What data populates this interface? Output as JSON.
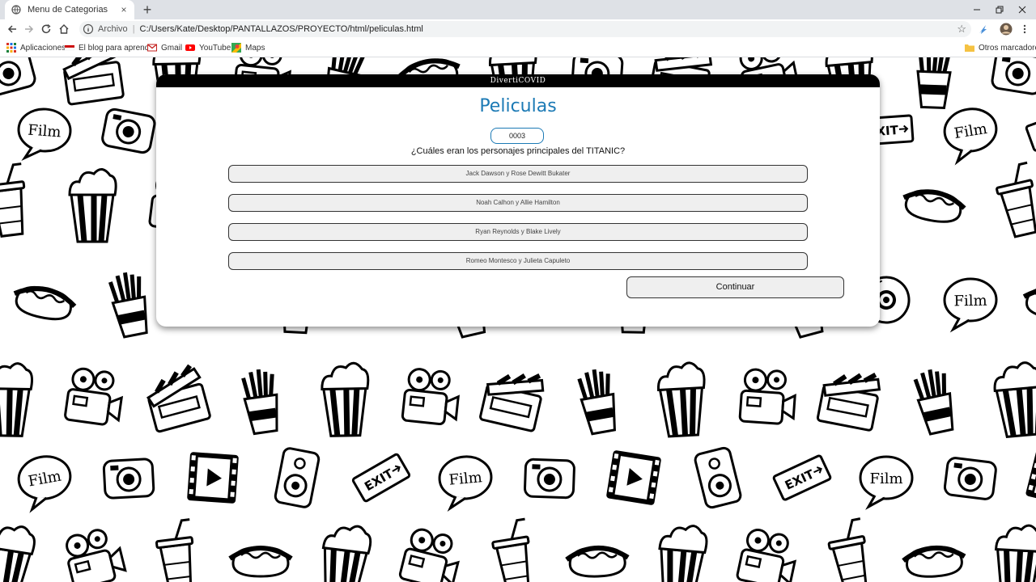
{
  "browser": {
    "tab_title": "Menu de Categorias",
    "tab_close": "×",
    "new_tab": "+",
    "address_secure_label": "Archivo",
    "address_url": "C:/Users/Kate/Desktop/PANTALLAZOS/PROYECTO/html/peliculas.html",
    "bookmarks": [
      "Aplicaciones",
      "El blog para aprend...",
      "Gmail",
      "YouTube",
      "Maps"
    ],
    "other_bookmarks": "Otros marcadores",
    "colors": {
      "tabstrip": "#dee1e6",
      "accent": "#1c7ab5"
    }
  },
  "card": {
    "header": "DivertiCOVID",
    "category_title": "Peliculas",
    "code": "0003",
    "question": "¿Cuáles eran los personajes principales del TITANIC?",
    "answers": [
      "Jack Dawson y Rose Dewitt Bukater",
      "Noah Calhon y Allie Hamilton",
      "Ryan Reynolds y Blake Lively",
      "Romeo Montesco y Julieta Capuleto"
    ],
    "continue_label": "Continuar"
  },
  "background": {
    "pattern_icons": [
      "camera-icon",
      "popcorn-icon",
      "clapperboard-icon",
      "film-reel-camera-icon",
      "fries-icon",
      "hotdog-icon",
      "exit-sign-icon",
      "film-bubble-icon",
      "play-button-icon",
      "soda-cup-icon",
      "dvd-icon",
      "speaker-icon"
    ]
  }
}
